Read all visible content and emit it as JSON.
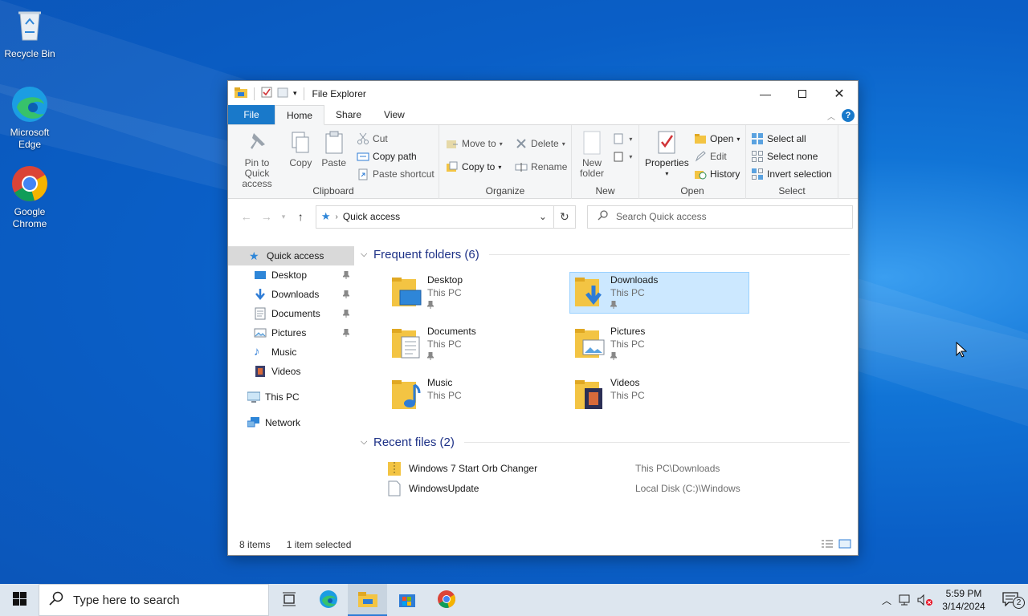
{
  "desktop": {
    "icons": [
      {
        "label": "Recycle Bin",
        "icon": "recycle-bin-icon"
      },
      {
        "label": "Microsoft Edge",
        "icon": "edge-icon"
      },
      {
        "label": "Google Chrome",
        "icon": "chrome-icon"
      }
    ]
  },
  "window": {
    "title": "File Explorer",
    "tabs": [
      "File",
      "Home",
      "Share",
      "View"
    ],
    "active_tab": "Home"
  },
  "ribbon": {
    "clipboard": {
      "label": "Clipboard",
      "pin": "Pin to Quick access",
      "copy": "Copy",
      "paste": "Paste",
      "cut": "Cut",
      "copy_path": "Copy path",
      "paste_shortcut": "Paste shortcut"
    },
    "organize": {
      "label": "Organize",
      "move_to": "Move to",
      "copy_to": "Copy to",
      "delete": "Delete",
      "rename": "Rename"
    },
    "new": {
      "label": "New",
      "new_folder": "New folder"
    },
    "open": {
      "label": "Open",
      "properties": "Properties",
      "open": "Open",
      "edit": "Edit",
      "history": "History"
    },
    "select": {
      "label": "Select",
      "select_all": "Select all",
      "select_none": "Select none",
      "invert": "Invert selection"
    }
  },
  "address": {
    "path": "Quick access",
    "search_placeholder": "Search Quick access"
  },
  "nav": {
    "quick_access": "Quick access",
    "items": [
      "Desktop",
      "Downloads",
      "Documents",
      "Pictures",
      "Music",
      "Videos"
    ],
    "this_pc": "This PC",
    "network": "Network"
  },
  "frequent": {
    "header": "Frequent folders (6)",
    "folders": [
      {
        "name": "Desktop",
        "sub": "This PC"
      },
      {
        "name": "Downloads",
        "sub": "This PC"
      },
      {
        "name": "Documents",
        "sub": "This PC"
      },
      {
        "name": "Pictures",
        "sub": "This PC"
      },
      {
        "name": "Music",
        "sub": "This PC"
      },
      {
        "name": "Videos",
        "sub": "This PC"
      }
    ]
  },
  "recent": {
    "header": "Recent files (2)",
    "files": [
      {
        "name": "Windows 7 Start Orb Changer",
        "path": "This PC\\Downloads"
      },
      {
        "name": "WindowsUpdate",
        "path": "Local Disk (C:)\\Windows"
      }
    ]
  },
  "status": {
    "items": "8 items",
    "selected": "1 item selected"
  },
  "taskbar": {
    "search_placeholder": "Type here to search",
    "time": "5:59 PM",
    "date": "3/14/2024",
    "notifications": "2"
  },
  "colors": {
    "accent": "#1979ca",
    "selection": "#cce8ff",
    "folder": "#f3c443"
  }
}
